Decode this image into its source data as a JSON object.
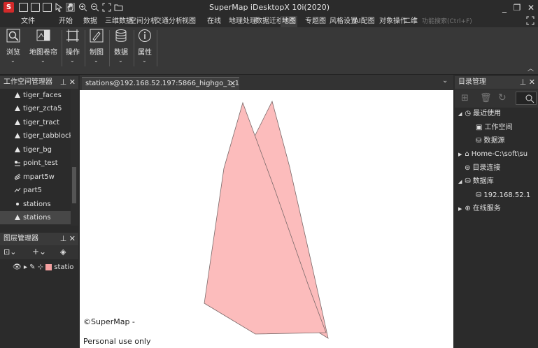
{
  "window": {
    "title": "SuperMap iDesktopX 10i(2020)"
  },
  "menu": {
    "tabs": [
      "文件",
      "开始",
      "数据",
      "三维数据",
      "空间分析",
      "交通分析",
      "视图",
      "在线",
      "地理处理",
      "数据迁移",
      "地图",
      "专题图",
      "风格设置",
      "AI配图",
      "对象操作",
      "二维"
    ],
    "active": "地图",
    "search_placeholder": "功能搜索(Ctrl+F)"
  },
  "ribbon": {
    "groups": [
      "浏览",
      "地图卷帘",
      "操作",
      "制图",
      "数据",
      "属性"
    ]
  },
  "workspace_panel": {
    "title": "工作空间管理器",
    "items": [
      {
        "label": "tiger_faces",
        "icon": "region-icon"
      },
      {
        "label": "tiger_zcta5",
        "icon": "region-icon"
      },
      {
        "label": "tiger_tract",
        "icon": "region-icon"
      },
      {
        "label": "tiger_tabblock",
        "icon": "region-icon"
      },
      {
        "label": "tiger_bg",
        "icon": "region-icon"
      },
      {
        "label": "point_test",
        "icon": "point-multi-icon"
      },
      {
        "label": "mpart5w",
        "icon": "multiline-icon"
      },
      {
        "label": "part5",
        "icon": "line-icon"
      },
      {
        "label": "stations",
        "icon": "point-icon"
      },
      {
        "label": "stations",
        "icon": "region-icon"
      }
    ],
    "selected_index": 9
  },
  "layer_panel": {
    "title": "图层管理器",
    "layer_label": "statio"
  },
  "map": {
    "tab_title": "stations@192.168.52.197:5866_highgo_1_1",
    "copyright": "©SuperMap -",
    "license_note": "Personal use only",
    "polygon_fill": "#fcbcbc",
    "polygon_stroke": "#7a6a6a"
  },
  "catalog_panel": {
    "title": "目录管理",
    "items": [
      {
        "label": "最近使用",
        "icon": "clock-icon"
      },
      {
        "label": "工作空间",
        "icon": "workspace-icon"
      },
      {
        "label": "数据源",
        "icon": "datasource-icon"
      },
      {
        "label": "Home-C:\\soft\\su",
        "icon": "home-icon"
      },
      {
        "label": "目录连接",
        "icon": "link-icon"
      },
      {
        "label": "数据库",
        "icon": "database-icon"
      },
      {
        "label": "192.168.52.1",
        "icon": "datasource-icon"
      },
      {
        "label": "在线服务",
        "icon": "globe-icon"
      }
    ]
  }
}
